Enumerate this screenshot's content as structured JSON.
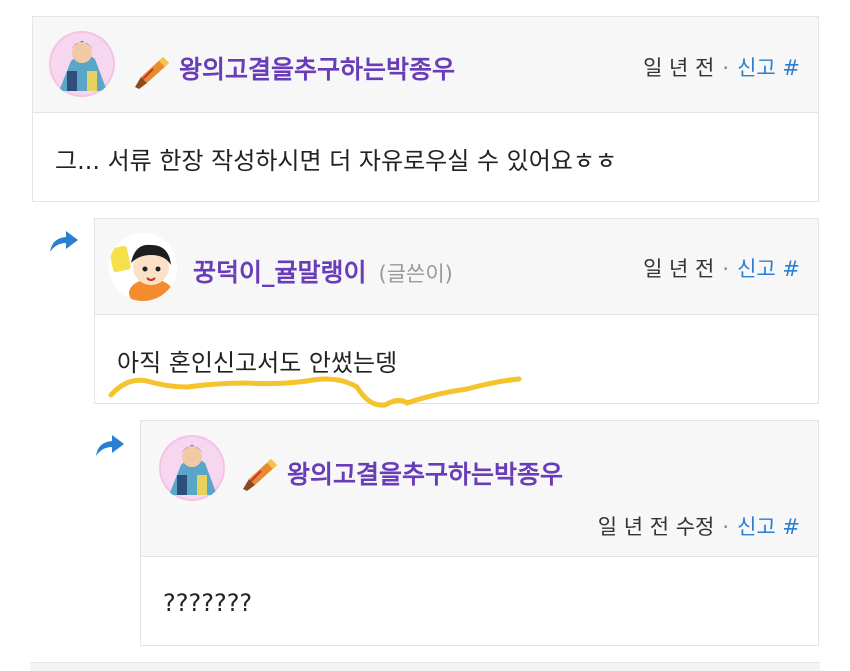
{
  "comments": [
    {
      "nick": "왕의고결을추구하는박종우",
      "time": "일 년 전",
      "report": "신고",
      "anchor": "#",
      "text": "그... 서류 한장 작성하시면 더 자유로우실 수 있어요ㅎㅎ"
    },
    {
      "nick": "꿍덕이_귤말랭이",
      "author_tag": "(글쓴이)",
      "time": "일 년 전",
      "report": "신고",
      "anchor": "#",
      "text": "아직 혼인신고서도 안썼는뎅"
    },
    {
      "nick": "왕의고결을추구하는박종우",
      "time": "일 년 전 수정",
      "report": "신고",
      "anchor": "#",
      "text": "???????"
    }
  ],
  "colors": {
    "nick": "#6a3db8",
    "link": "#2a7fd0",
    "reply_arrow": "#2a7fd0",
    "highlight_underline": "#f5c32c"
  },
  "icons": [
    "reply-arrow-icon",
    "brush-badge-icon"
  ]
}
